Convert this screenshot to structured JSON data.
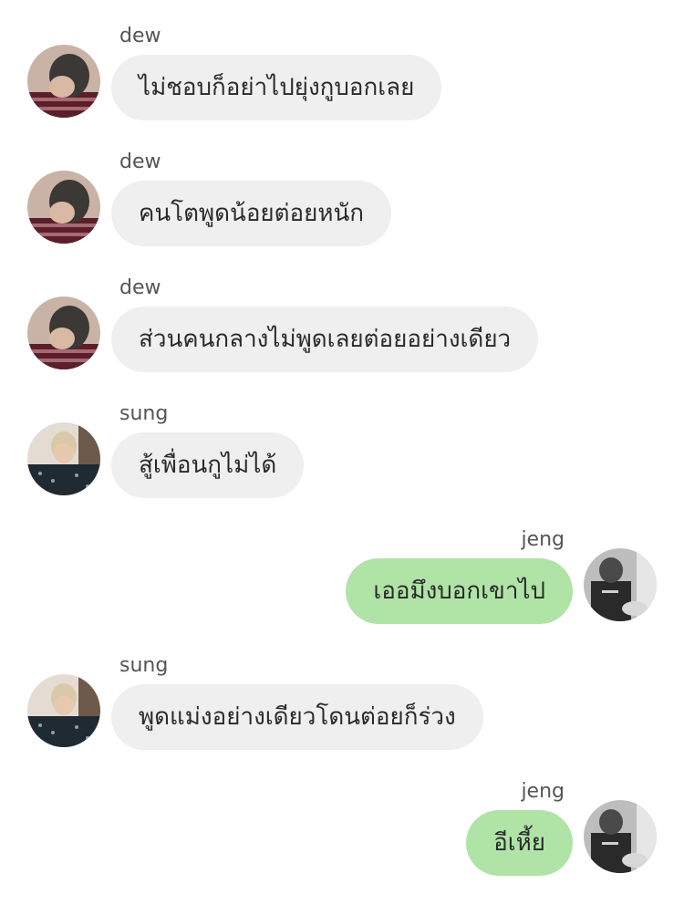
{
  "colors": {
    "incoming_bubble": "#efefef",
    "outgoing_bubble": "#b0e4a7",
    "sender_text": "#555555",
    "message_text": "#2a2a2a"
  },
  "messages": [
    {
      "sender": "dew",
      "text": "ไม่ชอบก็อย่าไปยุ่งกูบอกเลย",
      "direction": "incoming",
      "avatar": "avatar-dew"
    },
    {
      "sender": "dew",
      "text": "คนโตพูดน้อยต่อยหนัก",
      "direction": "incoming",
      "avatar": "avatar-dew"
    },
    {
      "sender": "dew",
      "text": "ส่วนคนกลางไม่พูดเลยต่อยอย่างเดียว",
      "direction": "incoming",
      "avatar": "avatar-dew"
    },
    {
      "sender": "sung",
      "text": "สู้เพื่อนกูไม่ได้",
      "direction": "incoming",
      "avatar": "avatar-sung"
    },
    {
      "sender": "jeng",
      "text": "เออมึงบอกเขาไป",
      "direction": "outgoing",
      "avatar": "avatar-jeng"
    },
    {
      "sender": "sung",
      "text": "พูดแม่งอย่างเดียวโดนต่อยก็ร่วง",
      "direction": "incoming",
      "avatar": "avatar-sung"
    },
    {
      "sender": "jeng",
      "text": "อีเหี้ย",
      "direction": "outgoing",
      "avatar": "avatar-jeng"
    }
  ]
}
